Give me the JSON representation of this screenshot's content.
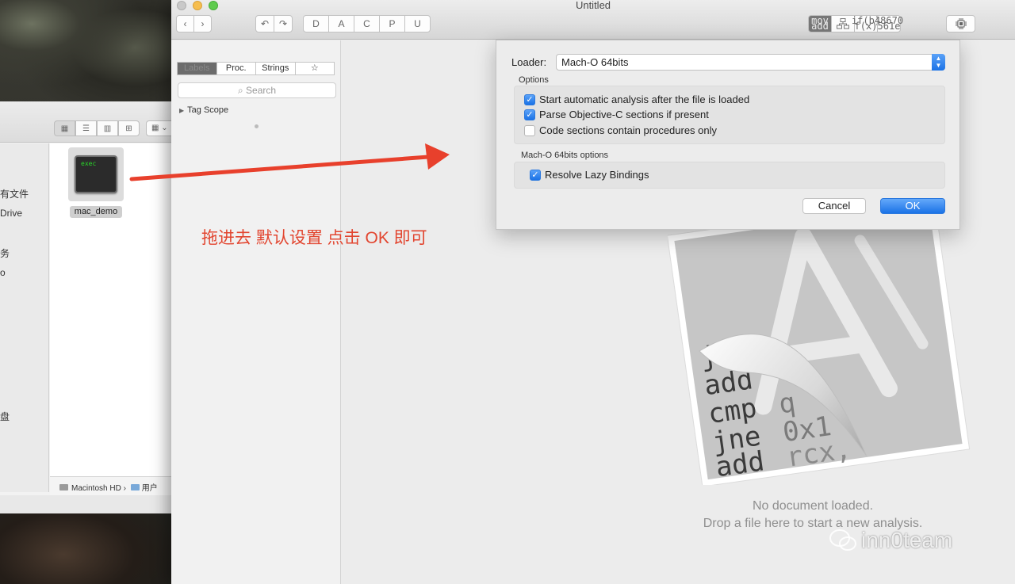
{
  "finder": {
    "sidebar_fragments": [
      "有文件",
      "Drive",
      "务",
      "o",
      "盘"
    ],
    "file": {
      "icon_text": "exec",
      "name": "mac_demo"
    },
    "path": {
      "disk": "Macintosh HD",
      "sep": "›",
      "folder": "用户"
    },
    "view_icons": [
      "grid-icon",
      "list-icon",
      "column-icon",
      "gallery-icon"
    ],
    "arrange_icon": "arrange-icon"
  },
  "hopper": {
    "title": "Untitled",
    "toolbar": {
      "nav": [
        "‹",
        "›"
      ],
      "history": [
        "↶",
        "↷"
      ],
      "modes": [
        "D",
        "A",
        "C",
        "P",
        "U"
      ],
      "view_modes": [
        {
          "line1": "mov",
          "line2": "add",
          "active": true
        },
        {
          "line1": "cfg",
          "line2": "",
          "active": false
        },
        {
          "line1": "if(b)",
          "line2": "f(x)",
          "active": false
        },
        {
          "line1": "48670",
          "line2": "561e",
          "active": false
        }
      ],
      "chip_icon": "cpu-icon"
    },
    "sidebar": {
      "tabs": [
        {
          "label": "Labels",
          "active": true
        },
        {
          "label": "Proc.",
          "active": false
        },
        {
          "label": "Strings",
          "active": false
        },
        {
          "label": "☆",
          "active": false
        }
      ],
      "search_placeholder": "Search",
      "tag_scope": "Tag Scope"
    },
    "empty_state": {
      "line1": "No document loaded.",
      "line2": "Drop a file here to start a new analysis.",
      "art_code_lines": [
        "j.",
        "add",
        "cmp",
        "jne",
        "add"
      ],
      "art_code_fragments": [
        "q",
        "0x1",
        "rcx,"
      ]
    }
  },
  "dialog": {
    "loader_label": "Loader:",
    "loader_value": "Mach-O 64bits",
    "options_title": "Options",
    "options": [
      {
        "label": "Start automatic analysis after the file is loaded",
        "checked": true
      },
      {
        "label": "Parse Objective-C sections if present",
        "checked": true
      },
      {
        "label": "Code sections contain procedures only",
        "checked": false
      }
    ],
    "macho_title": "Mach-O 64bits options",
    "macho_options": [
      {
        "label": "Resolve Lazy Bindings",
        "checked": true
      }
    ],
    "cancel_label": "Cancel",
    "ok_label": "OK"
  },
  "annotation": {
    "text": "拖进去 默认设置 点击 OK 即可",
    "color": "#e2452f"
  },
  "watermark": {
    "text": "inn0team"
  }
}
